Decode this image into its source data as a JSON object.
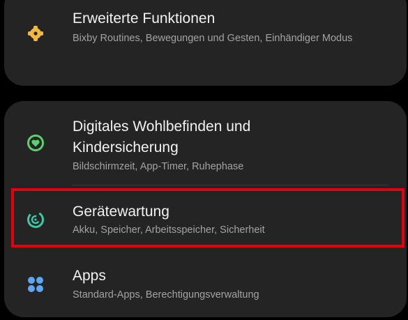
{
  "settings": {
    "advanced": {
      "title": "Erweiterte Funktionen",
      "subtitle": "Bixby Routines, Bewegungen und Gesten, Einhändiger Modus",
      "icon": "puzzle-gear-icon",
      "icon_color": "#f4b83f"
    },
    "wellbeing": {
      "title_line1": "Digitales Wohlbefinden und",
      "title_line2": "Kindersicherung",
      "subtitle": "Bildschirmzeit, App-Timer, Ruhephase",
      "icon": "wellbeing-heart-icon",
      "icon_color": "#5bd16b"
    },
    "device_care": {
      "title": "Gerätewartung",
      "subtitle": "Akku, Speicher, Arbeitsspeicher, Sicherheit",
      "icon": "device-care-icon",
      "icon_color": "#3cc9a6"
    },
    "apps": {
      "title": "Apps",
      "subtitle": "Standard-Apps, Berechtigungsverwaltung",
      "icon": "apps-grid-icon",
      "icon_color": "#5ca8f5"
    }
  },
  "highlight_color": "#e3000f"
}
